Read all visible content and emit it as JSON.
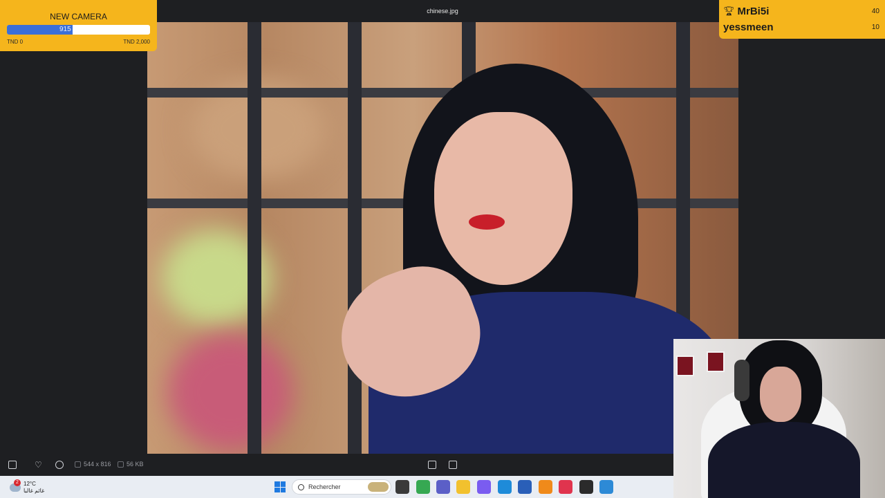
{
  "viewer": {
    "file_title": "chinese.jpg",
    "toolbar": {
      "dimensions": "544 x 816",
      "file_size": "56 KB"
    }
  },
  "goal": {
    "title": "NEW CAMERA",
    "current": 915,
    "current_label": "915",
    "min_label": "TND 0",
    "max_label": "TND 2,000",
    "progress_fraction": 0.4575,
    "fill_color": "#3b6fd8"
  },
  "leaderboard": {
    "entries": [
      {
        "name": "MrBi5i",
        "score": "40",
        "icon": "trophy-icon"
      },
      {
        "name": "yessmeen",
        "score": "10"
      }
    ]
  },
  "taskbar": {
    "weather_badge": "2",
    "temperature": "12°C",
    "condition": "غائم غالبا",
    "search_placeholder": "Rechercher"
  },
  "colors": {
    "overlay_accent": "#f5b51c",
    "viewer_bg": "#1e1f22",
    "taskbar_bg": "#e9edf3"
  }
}
